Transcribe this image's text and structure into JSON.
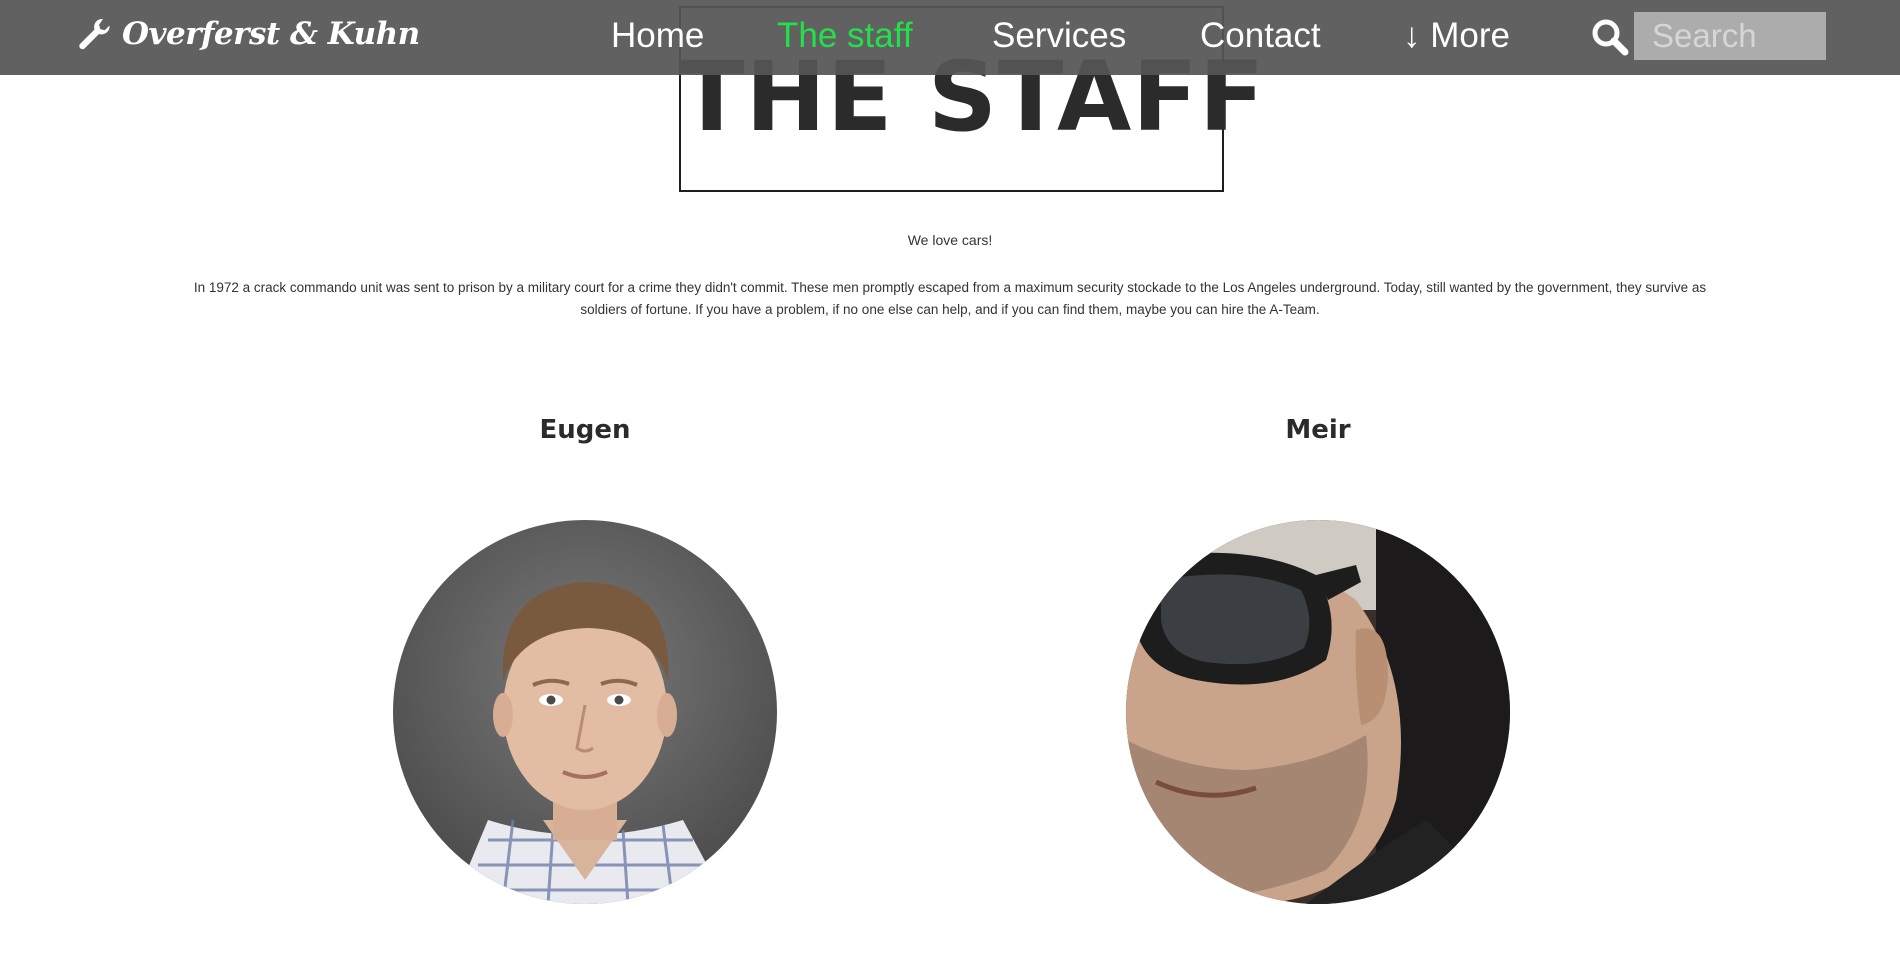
{
  "brand": {
    "name": "Overferst & Kuhn",
    "icon": "wrench-icon"
  },
  "nav": {
    "items": [
      {
        "label": "Home",
        "active": false
      },
      {
        "label": "The staff",
        "active": true
      },
      {
        "label": "Services",
        "active": false
      },
      {
        "label": "Contact",
        "active": false
      },
      {
        "label": "↓ More",
        "active": false
      }
    ],
    "active_color": "#22e04a",
    "bar_color": "#555555"
  },
  "search": {
    "icon": "search-icon",
    "placeholder": "Search",
    "value": ""
  },
  "page": {
    "title": "THE STAFF",
    "tagline": "We love cars!",
    "intro": "In 1972 a crack commando unit was sent to prison by a military court for a crime they didn't commit. These men promptly escaped from a maximum security stockade to the Los Angeles underground. Today, still wanted by the government, they survive as soldiers of fortune. If you have a problem, if no one else can help, and if you can find them, maybe you can hire the A-Team."
  },
  "staff": [
    {
      "name": "Eugen"
    },
    {
      "name": "Meir"
    }
  ]
}
